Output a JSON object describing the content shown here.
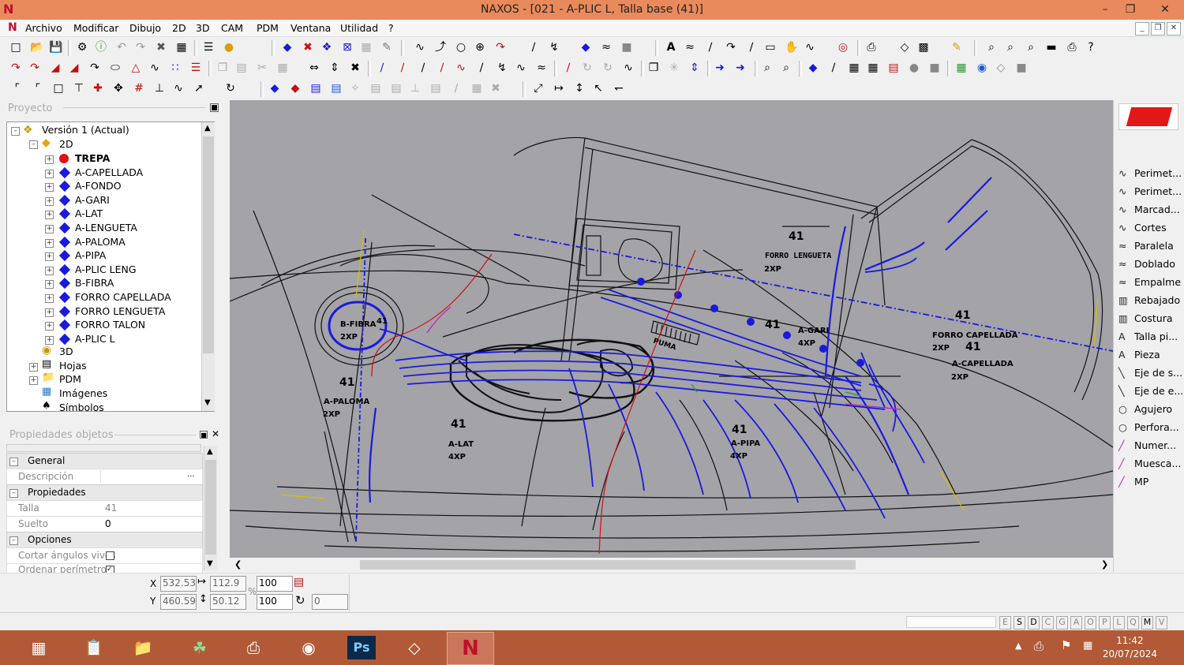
{
  "window": {
    "title": "NAXOS - [021 - A-PLIC L, Talla base (41)]"
  },
  "menu": [
    "Archivo",
    "Modificar",
    "Dibujo",
    "2D",
    "3D",
    "CAM",
    "PDM",
    "Ventana",
    "Utilidad",
    "?"
  ],
  "project": {
    "header": "Proyecto",
    "root": "Versión 1 (Actual)",
    "group2d": "2D",
    "items": [
      {
        "label": "TREPA",
        "active": true
      },
      {
        "label": "A-CAPELLADA"
      },
      {
        "label": "A-FONDO"
      },
      {
        "label": "A-GARI"
      },
      {
        "label": "A-LAT"
      },
      {
        "label": "A-LENGUETA"
      },
      {
        "label": "A-PALOMA"
      },
      {
        "label": "A-PIPA"
      },
      {
        "label": "A-PLIC LENG"
      },
      {
        "label": "B-FIBRA"
      },
      {
        "label": "FORRO CAPELLADA"
      },
      {
        "label": "FORRO LENGUETA"
      },
      {
        "label": "FORRO TALON"
      },
      {
        "label": "A-PLIC L"
      }
    ],
    "others": [
      "3D",
      "Hojas",
      "PDM",
      "Imágenes",
      "Símbolos"
    ]
  },
  "properties": {
    "header": "Propiedades objetos",
    "general": "General",
    "descripcion_label": "Descripción",
    "propiedades": "Propiedades",
    "talla_label": "Talla",
    "talla_value": "41",
    "suelto_label": "Suelto",
    "suelto_value": "0",
    "opciones": "Opciones",
    "cortar_label": "Cortar ángulos vivos",
    "ordenar_label": "Ordenar perímetro"
  },
  "right_panel": [
    "Perimet...",
    "Perimet...",
    "Marcad...",
    "Cortes",
    "Paralela",
    "Doblado",
    "Empalme",
    "Rebajado",
    "Costura",
    "Talla pi...",
    "Pieza",
    "Eje de s...",
    "Eje de e...",
    "Agujero",
    "Perfora...",
    "Numer...",
    "Muesca...",
    "MP"
  ],
  "coords": {
    "x_label": "X",
    "y_label": "Y",
    "x": "532.53",
    "y": "460.59",
    "w": "112.9",
    "h": "50.12",
    "sx": "100",
    "sy": "100",
    "pct": "%",
    "angle": "0"
  },
  "status_letters": [
    "E",
    "S",
    "D",
    "C",
    "G",
    "A",
    "O",
    "P",
    "L",
    "Q",
    "M",
    "V"
  ],
  "drawing_labels": {
    "forro_lengueta": "FORRO LENGUETA",
    "forro_lengueta_qty": "2XP",
    "forro_lengueta_size": "41",
    "forro_capellada": "FORRO CAPELLADA",
    "forro_capellada_qty": "2XP",
    "a_capellada": "A-CAPELLADA",
    "a_capellada_qty": "2XP",
    "a_gari": "A-GARI",
    "a_gari_qty": "4XP",
    "a_lat": "A-LAT",
    "a_lat_qty": "4XP",
    "a_pipa": "A-PIPA",
    "a_pipa_qty": "4XP",
    "a_paloma": "A-PALOMA",
    "a_paloma_qty": "2XP",
    "b_fibra": "B-FIBRA",
    "b_fibra_qty": "2XP",
    "size": "41",
    "puma": "PUMA"
  },
  "taskbar": {
    "time": "11:42",
    "date": "20/07/2024"
  }
}
